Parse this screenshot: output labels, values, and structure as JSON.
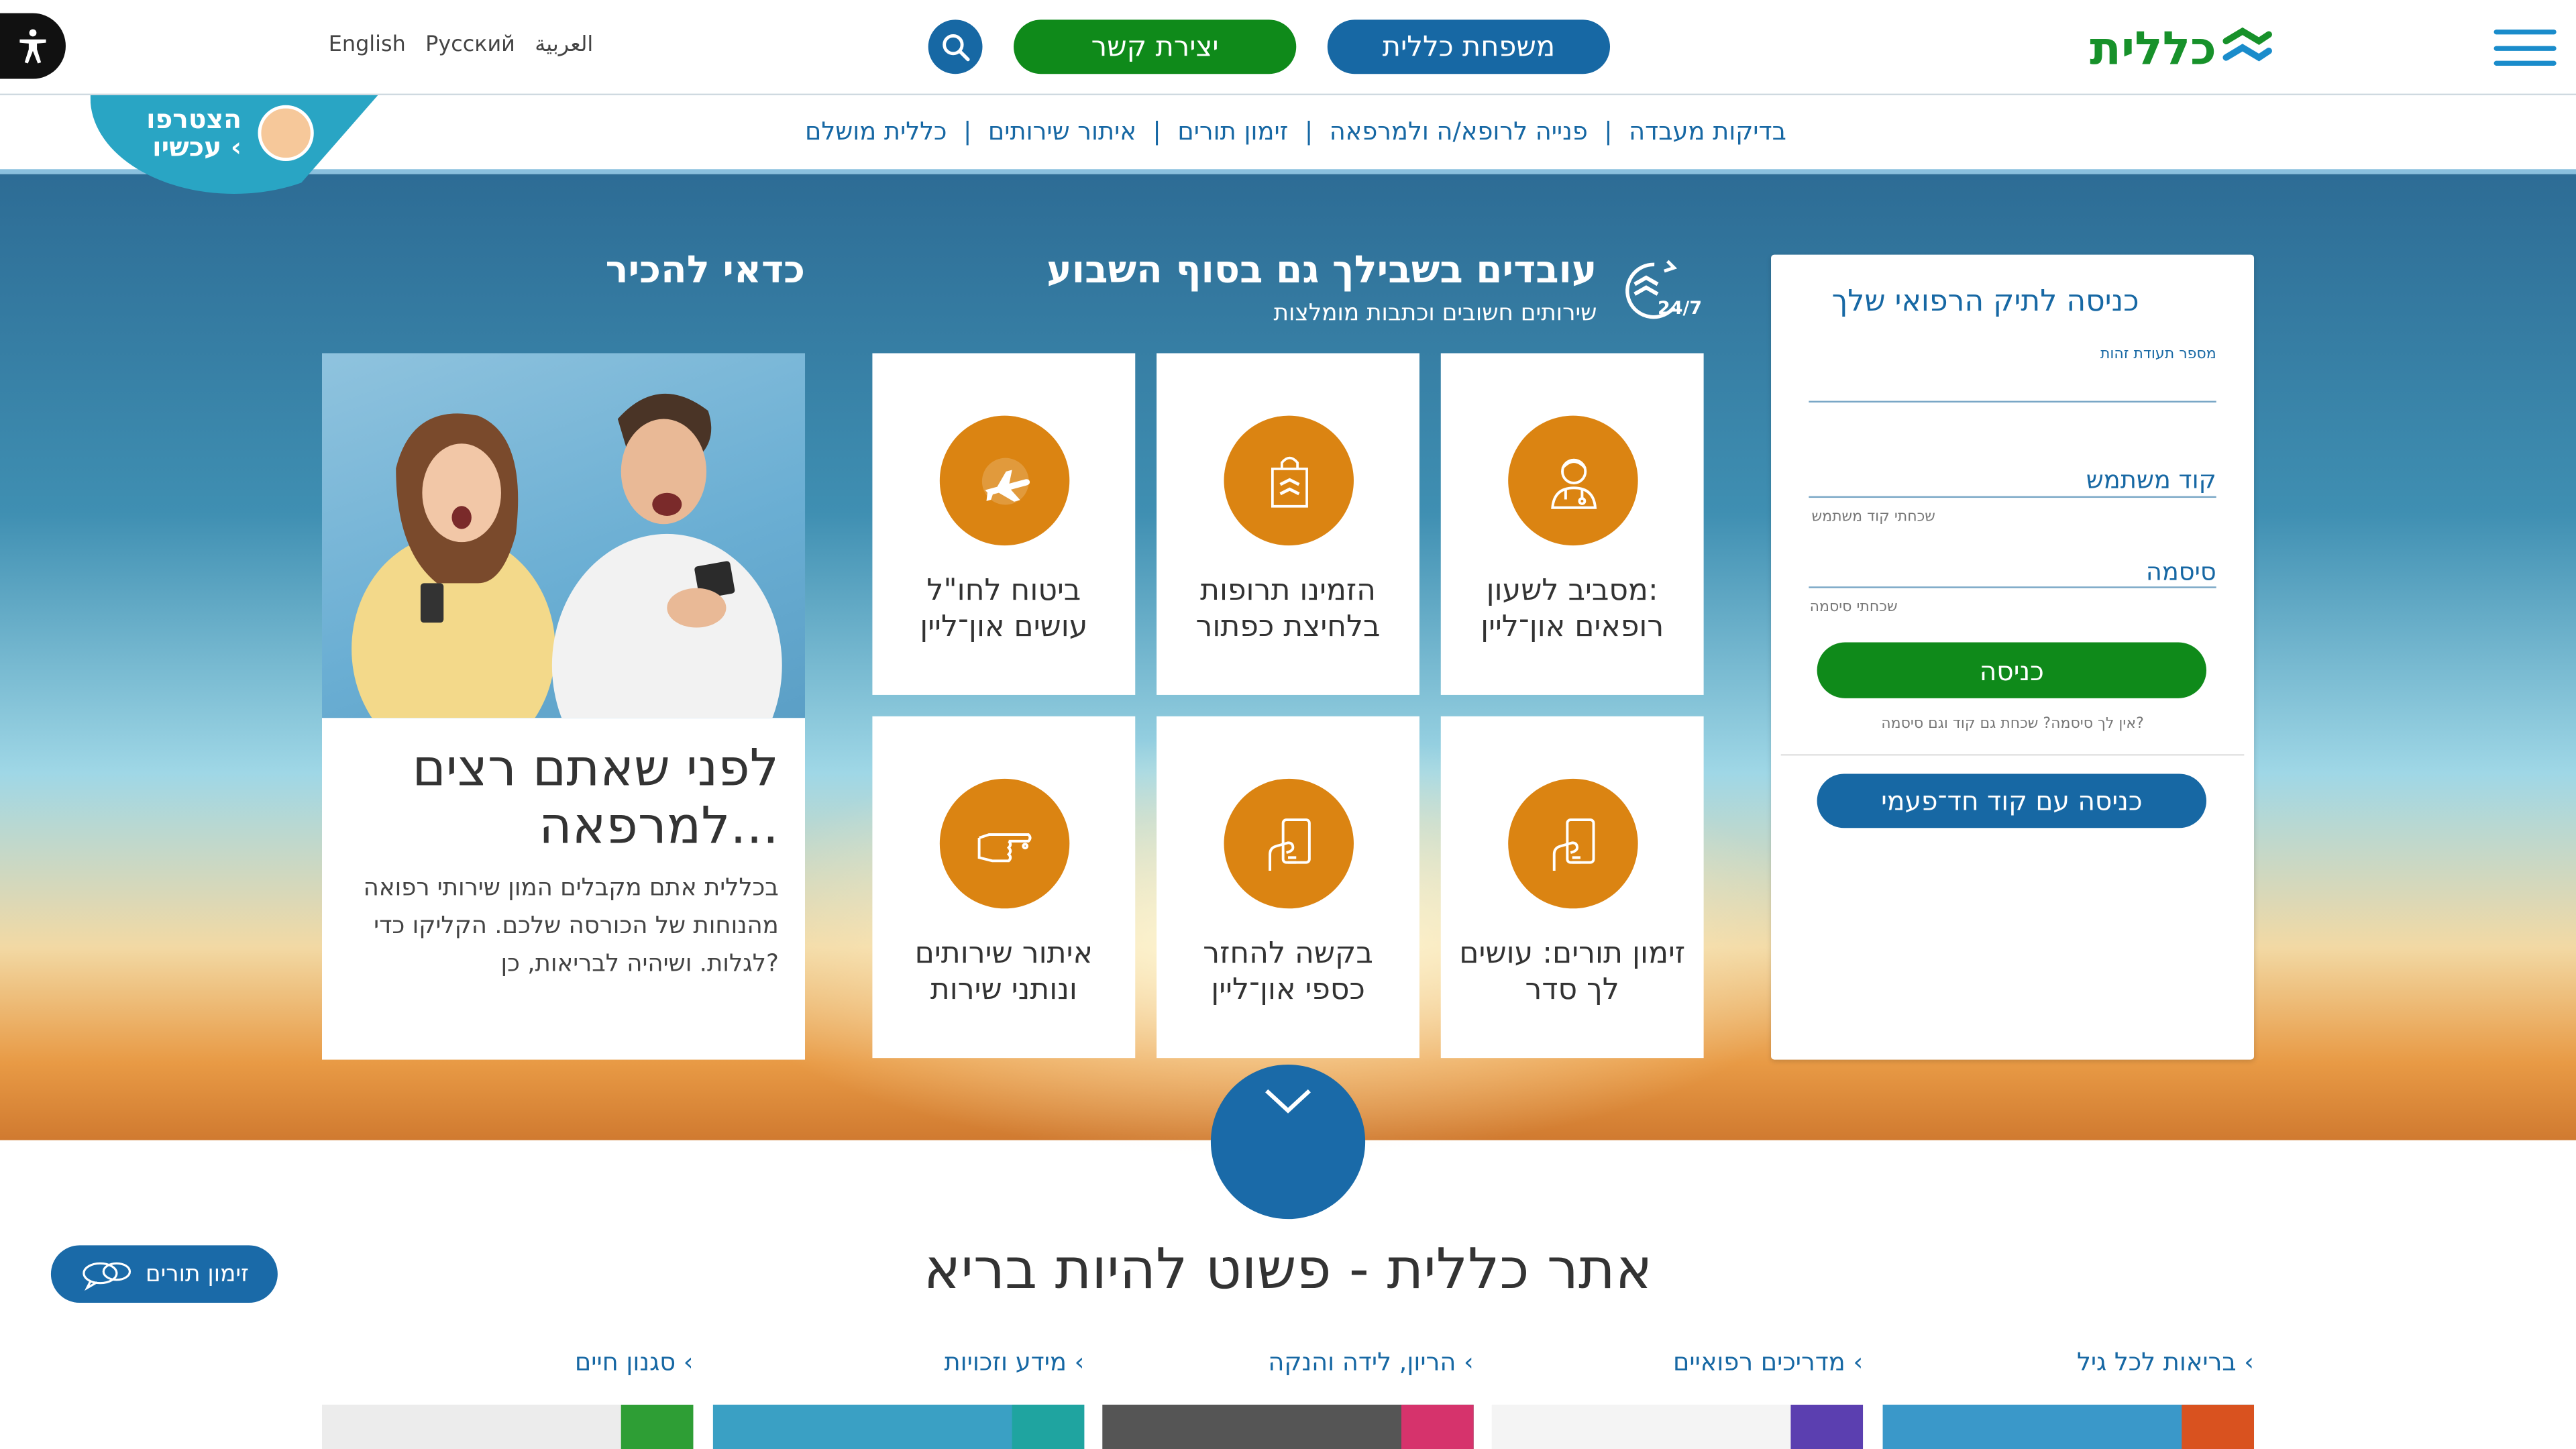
{
  "header": {
    "languages": [
      "English",
      "Русский",
      "العربية"
    ],
    "contact_button": "יצירת קשר",
    "family_button": "משפחת כללית",
    "logo_text": "כללית"
  },
  "nav": {
    "items": [
      "בדיקות מעבדה",
      "פנייה לרופא/ה ולמרפאה",
      "זימון תורים",
      "איתור שירותים",
      "כללית מושלם"
    ]
  },
  "join_banner": {
    "line1": "הצטרפו",
    "line2": "עכשיו"
  },
  "login": {
    "title": "כניסה לתיק הרפואי שלך",
    "id_label": "מספר תעודת זהות",
    "user_code_placeholder": "קוד משתמש",
    "forgot_user_code": "שכחתי קוד משתמש",
    "password_placeholder": "סיסמה",
    "forgot_password": "שכחתי סיסמה",
    "login_button": "כניסה",
    "no_password_hint": "אין לך סיסמה? שכחת גם קוד וגם סיסמה?",
    "otp_button": "כניסה עם קוד חד־פעמי"
  },
  "services": {
    "title": "עובדים בשבילך גם בסוף השבוע",
    "subtitle": "שירותים חשובים וכתבות מומלצות",
    "badge": "24/7",
    "tiles": [
      {
        "line1": "מסביב לשעון:",
        "line2": "רופאים און־ליין",
        "icon": "doctor-icon"
      },
      {
        "line1": "הזמינו תרופות",
        "line2": "בלחיצת כפתור",
        "icon": "shopping-bag-icon"
      },
      {
        "line1": "ביטוח לחו\"ל",
        "line2": "עושים און־ליין",
        "icon": "airplane-icon"
      },
      {
        "line1": "זימון תורים: עושים",
        "line2": "לך סדר",
        "icon": "phone-hand-icon"
      },
      {
        "line1": "בקשה להחזר",
        "line2": "כספי און־ליין",
        "icon": "phone-hand-icon"
      },
      {
        "line1": "איתור שירותים",
        "line2": "ונותני שירות",
        "icon": "pointing-hand-icon"
      }
    ]
  },
  "worth_knowing": {
    "title": "כדאי להכיר",
    "headline": "לפני שאתם רצים למרפאה...",
    "body": "בכללית אתם מקבלים המון שירותי רפואה מהנוחות של הכורסה שלכם. הקליקו כדי לגלות. ושיהיה לבריאות, כן?"
  },
  "main": {
    "title": "אתר כללית - פשוט להיות בריא",
    "appointments_button": "זימון תורים",
    "categories": [
      "בריאות לכל גיל",
      "מדריכים רפואיים",
      "הריון, לידה והנקה",
      "מידע וזכויות",
      "סגנון חיים"
    ]
  },
  "colors": {
    "primary_blue": "#1768a4",
    "green": "#0f8a1a",
    "orange": "#db8412"
  }
}
